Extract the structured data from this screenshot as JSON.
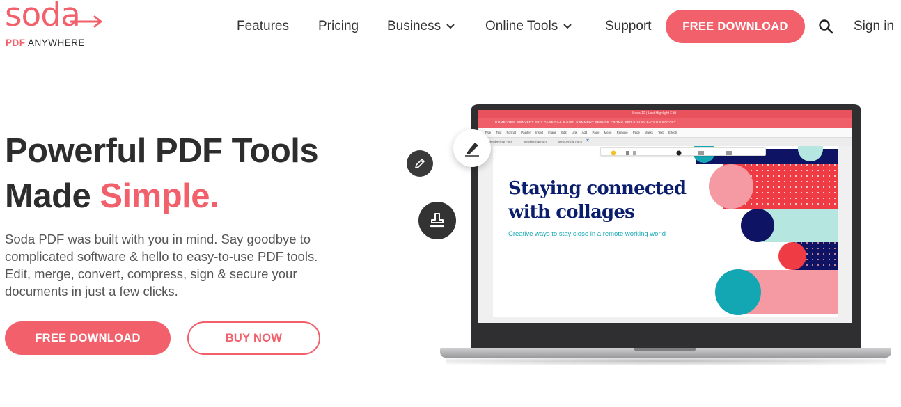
{
  "brand": {
    "name": "soda",
    "sub_highlight": "PDF",
    "sub_rest": "ANYWHERE",
    "color": "#f2616b"
  },
  "nav": {
    "items": [
      {
        "label": "Features",
        "dropdown": false
      },
      {
        "label": "Pricing",
        "dropdown": false
      },
      {
        "label": "Business",
        "dropdown": true
      },
      {
        "label": "Online Tools",
        "dropdown": true
      },
      {
        "label": "Support",
        "dropdown": false
      }
    ],
    "cta_label": "FREE DOWNLOAD",
    "search_icon": "search-icon",
    "signin_label": "Sign in"
  },
  "hero": {
    "title_line1": "Powerful PDF Tools",
    "title_line2_plain": "Made ",
    "title_line2_accent": "Simple.",
    "description": "Soda PDF was built with you in mind. Say goodbye to complicated software & hello to easy-to-use PDF tools. Edit, merge, convert, compress, sign & secure your documents in just a few clicks.",
    "primary_button": "FREE DOWNLOAD",
    "secondary_button": "BUY NOW",
    "floating_icons": [
      "pencil-icon",
      "stamp-icon",
      "marker-icon"
    ]
  },
  "screen": {
    "app_title": "Soda 12 | Last Highlight Edit",
    "menu": "HOME   VIEW   CONVERT   EDIT   PAGE   FILL & SIGN   COMMENT   SECURE   FORMS   OCR   E-SIGN   BATCH   CONTACT",
    "toolbar": "Type Text   Format Painter   Insert Image   Edit Link   Add Page Menu   Remove Page Marks   Text Effects",
    "tabs": [
      "Membership Form",
      "Membership Form",
      "Membership Form"
    ],
    "doc_title_line1": "Staying connected",
    "doc_title_line2": "with collages",
    "doc_subtitle": "Creative ways to stay close in a remote working world"
  }
}
